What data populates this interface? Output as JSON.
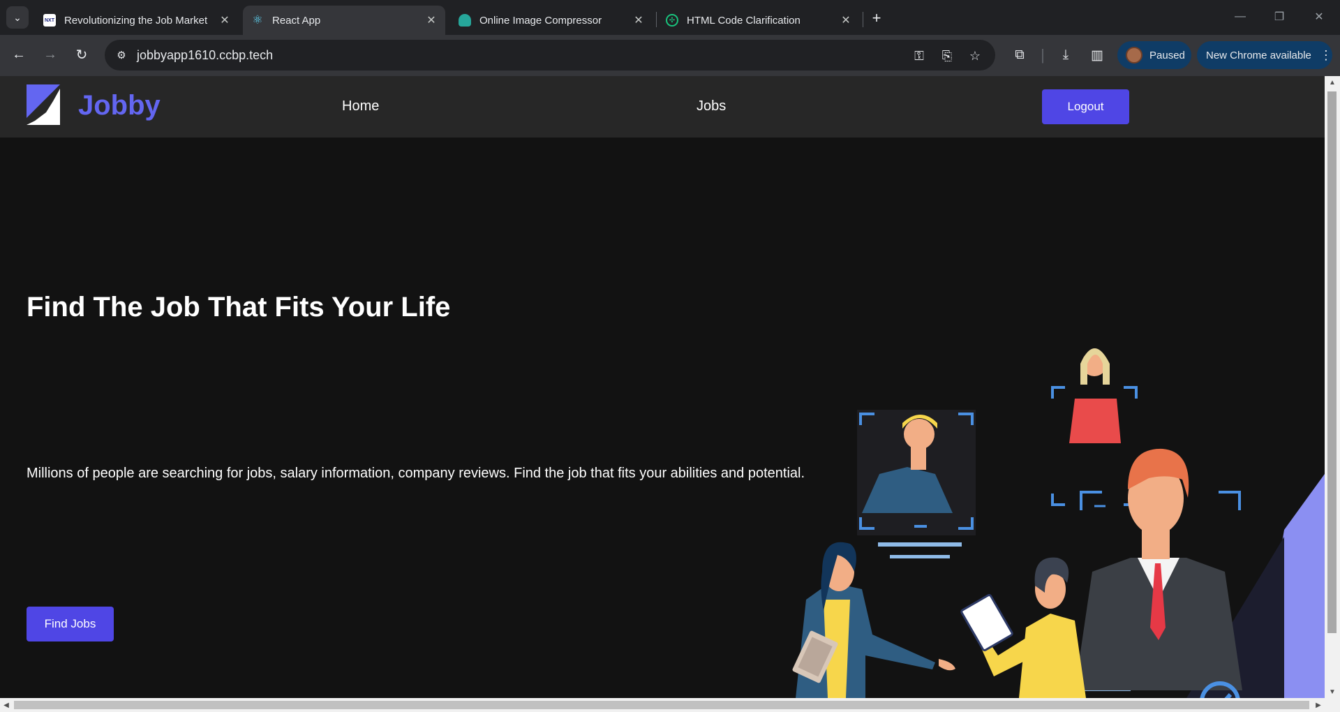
{
  "browser": {
    "tabs": [
      {
        "title": "Revolutionizing the Job Market",
        "favicon": "nxt-wave-favicon"
      },
      {
        "title": "React App",
        "favicon": "react-favicon",
        "active": true
      },
      {
        "title": "Online Image Compressor",
        "favicon": "cloud-favicon"
      },
      {
        "title": "HTML Code Clarification",
        "favicon": "chatgpt-favicon"
      }
    ],
    "url": "jobbyapp1610.ccbp.tech",
    "profile_status": "Paused",
    "update_label": "New Chrome available"
  },
  "app": {
    "logo_text": "Jobby",
    "nav": {
      "home": "Home",
      "jobs": "Jobs"
    },
    "logout_label": "Logout",
    "hero": {
      "title": "Find The Job That Fits Your Life",
      "description": "Millions of people are searching for jobs, salary information, company reviews. Find the job that fits your abilities and potential.",
      "cta_label": "Find Jobs"
    }
  },
  "colors": {
    "accent": "#4f46e5",
    "logo": "#6366f1",
    "nav_bg": "#272727",
    "page_bg": "#121212"
  }
}
